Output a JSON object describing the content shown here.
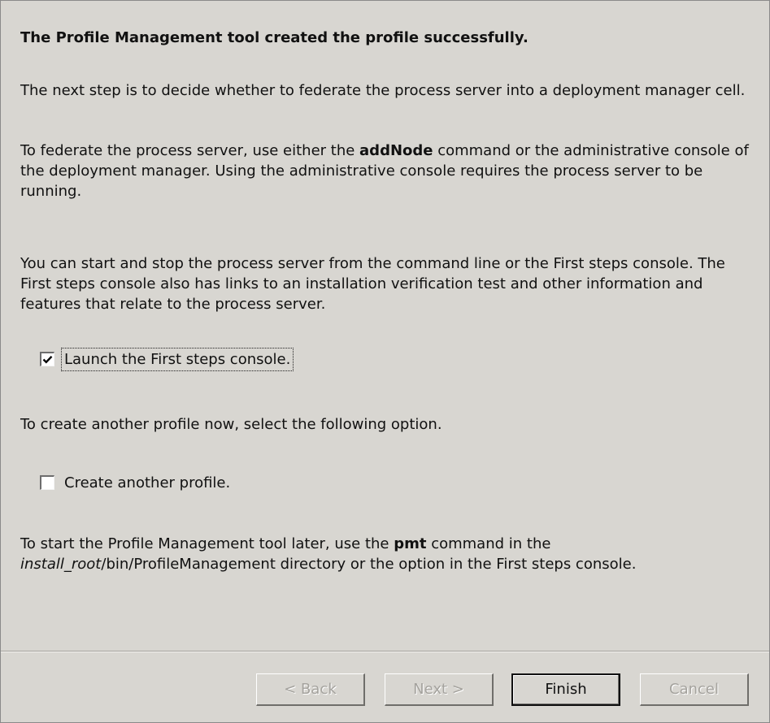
{
  "dialog": {
    "heading": "The Profile Management tool created the profile successfully.",
    "para_next_step": "The next step is to decide whether to federate the process server into a deployment manager cell.",
    "para_federate": {
      "prefix": "To federate the process server, use either the ",
      "command": "addNode",
      "suffix": " command or the administrative console of the deployment manager. Using the administrative console requires the process server to be running."
    },
    "para_start_stop": "You can start and stop the process server from the command line or the First steps console. The First steps console also has links to an installation verification test and other information and features that relate to the process server.",
    "launch_checkbox": {
      "label": "Launch the First steps console.",
      "checked": true
    },
    "para_create_another": "To create another profile now, select the following option.",
    "create_checkbox": {
      "label": "Create another profile.",
      "checked": false
    },
    "para_pmt": {
      "prefix": "To start the Profile Management tool later, use the ",
      "command": "pmt",
      "middle": " command in the",
      "path_italic": "install_root",
      "path_rest": "/bin/ProfileManagement directory or the option in the First steps console."
    }
  },
  "buttons": {
    "back": {
      "label": "< Back",
      "enabled": false
    },
    "next": {
      "label": "Next >",
      "enabled": false
    },
    "finish": {
      "label": "Finish",
      "enabled": true
    },
    "cancel": {
      "label": "Cancel",
      "enabled": false
    }
  }
}
